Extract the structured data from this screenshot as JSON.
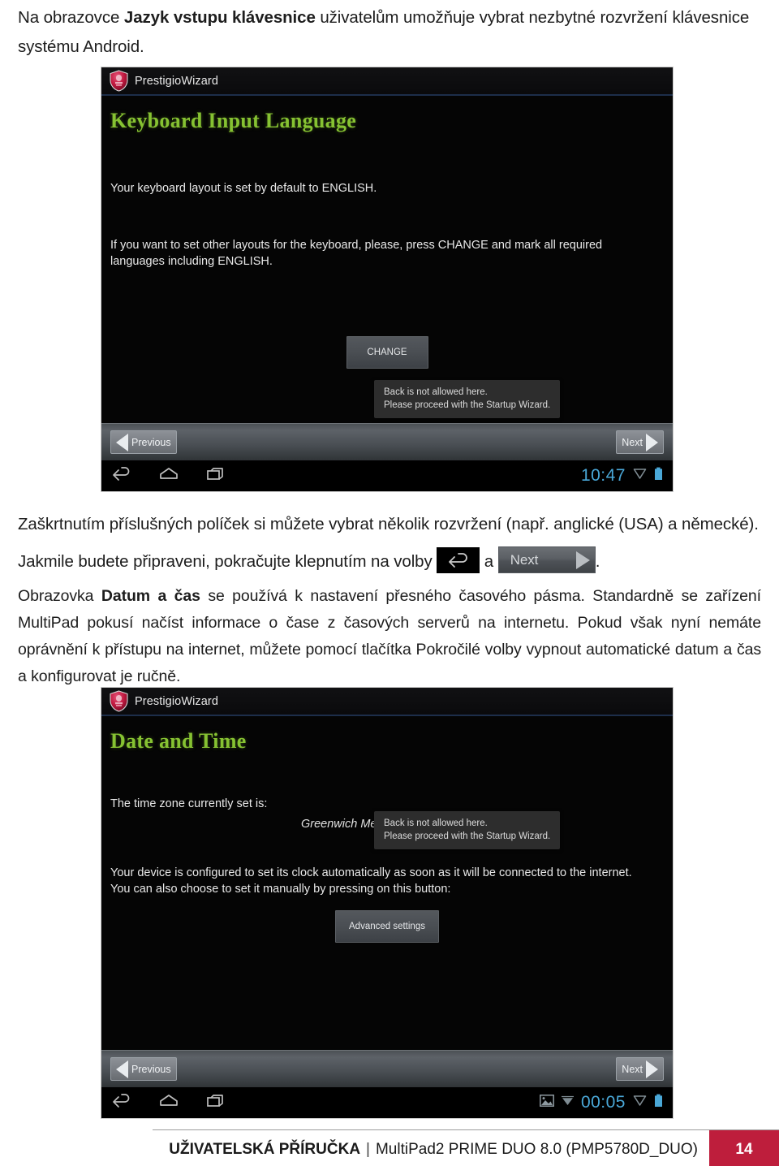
{
  "document": {
    "language": "cs",
    "intro_paragraph": {
      "before_bold": "Na obrazovce ",
      "bold": "Jazyk vstupu klávesnice",
      "after_bold": " uživatelům umožňuje vybrat nezbytné rozvržení klávesnice systému Android."
    },
    "paragraph_checkbox": "Zaškrtnutím příslušných políček si můžete vybrat několik rozvržení (např. anglické (USA) a německé).",
    "paragraph_ready": {
      "before_icons": "Jakmile budete připraveni, pokračujte klepnutím na volby ",
      "between_icons": " a ",
      "after_icons": "."
    },
    "paragraph_datetime": {
      "before_bold": "Obrazovka ",
      "bold": "Datum a čas",
      "after_bold": " se používá k nastavení přesného časového pásma. Standardně se zařízení MultiPad pokusí načíst informace o čase z časových serverů na internetu. Pokud však nyní nemáte oprávnění k přístupu na internet, můžete pomocí tlačítka Pokročilé volby vypnout automatické datum a čas a konfigurovat je ručně."
    }
  },
  "inline_controls": {
    "back_icon_name": "back-arrow-icon",
    "next_button_label": "Next"
  },
  "screenshot_keyboard": {
    "app_name": "PrestigioWizard",
    "heading": "Keyboard Input Language",
    "line1": "Your keyboard layout is set by default to ENGLISH.",
    "line2": "If you want to set other layouts for the keyboard, please, press CHANGE and mark all required languages including ENGLISH.",
    "change_button": "CHANGE",
    "toast_line1": "Back is not allowed here.",
    "toast_line2": "Please proceed with the Startup Wizard.",
    "previous_button": "Previous",
    "next_button": "Next",
    "status_time": "10:47"
  },
  "screenshot_datetime": {
    "app_name": "PrestigioWizard",
    "heading": "Date and Time",
    "timezone_label": "The time zone currently set is:",
    "timezone_value": "Greenwich Mean Time (GMT-0:00)",
    "info_line1": "Your device is configured to set its clock automatically as soon as it will be connected to the internet.",
    "info_line2": "You can also choose to set it manually by pressing on this button:",
    "advanced_button": "Advanced settings",
    "toast_line1": "Back is not allowed here.",
    "toast_line2": "Please proceed with the Startup Wizard.",
    "previous_button": "Previous",
    "next_button": "Next",
    "status_time": "00:05"
  },
  "footer": {
    "title_bold": "UŽIVATELSKÁ PŘÍRUČKA",
    "separator": "|",
    "product": "MultiPad2 PRIME DUO 8.0 (PMP5780D_DUO)",
    "page_number": "14"
  },
  "colors": {
    "accent_red": "#be1e3c",
    "heading_green": "#86c232",
    "clock_blue": "#4aa8d8",
    "screen_black": "#050505"
  }
}
